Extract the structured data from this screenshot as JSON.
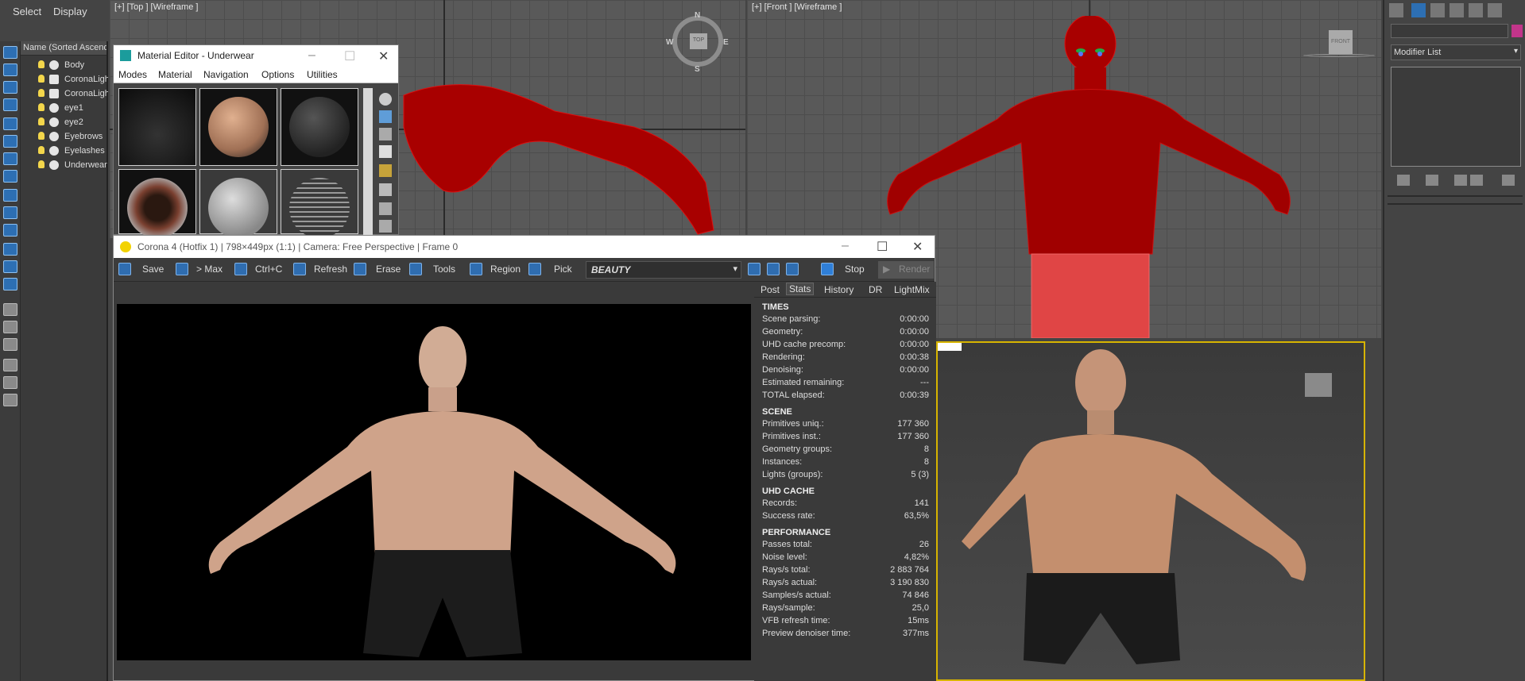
{
  "menu": {
    "select": "Select",
    "display": "Display"
  },
  "explorer": {
    "header": "Name (Sorted Ascendi",
    "items": [
      {
        "label": "Body",
        "type": "object"
      },
      {
        "label": "CoronaLigh",
        "type": "light"
      },
      {
        "label": "CoronaLigh",
        "type": "light"
      },
      {
        "label": "eye1",
        "type": "object"
      },
      {
        "label": "eye2",
        "type": "object"
      },
      {
        "label": "Eyebrows",
        "type": "object"
      },
      {
        "label": "Eyelashes",
        "type": "object"
      },
      {
        "label": "Underwear",
        "type": "object"
      }
    ]
  },
  "viewports": {
    "top_label": "[+] [Top ] [Wireframe ]",
    "front_label": "[+] [Front ] [Wireframe ]",
    "compass": {
      "n": "N",
      "s": "S",
      "e": "E",
      "w": "W",
      "cube": "TOP"
    },
    "front_cube": "FRONT"
  },
  "command_panel": {
    "modifier_list": "Modifier List",
    "accent": "#c2358a"
  },
  "material_editor": {
    "title": "Material Editor - Underwear",
    "menu": [
      "Modes",
      "Material",
      "Navigation",
      "Options",
      "Utilities"
    ]
  },
  "vfb": {
    "title": "Corona 4 (Hotfix 1) | 798×449px (1:1) | Camera: Free Perspective | Frame 0",
    "toolbar": {
      "save": "Save",
      "max": "> Max",
      "ctrlc": "Ctrl+C",
      "refresh": "Refresh",
      "erase": "Erase",
      "tools": "Tools",
      "region": "Region",
      "pick": "Pick",
      "channel": "BEAUTY",
      "stop": "Stop",
      "render": "Render"
    },
    "tabs": [
      "Post",
      "Stats",
      "History",
      "DR",
      "LightMix"
    ],
    "active_tab": "Stats",
    "sections": [
      {
        "title": "TIMES",
        "rows": [
          {
            "k": "Scene parsing:",
            "v": "0:00:00"
          },
          {
            "k": "Geometry:",
            "v": "0:00:00"
          },
          {
            "k": "UHD cache precomp:",
            "v": "0:00:00"
          },
          {
            "k": "Rendering:",
            "v": "0:00:38"
          },
          {
            "k": "Denoising:",
            "v": "0:00:00"
          },
          {
            "k": "Estimated remaining:",
            "v": "---"
          },
          {
            "k": "TOTAL elapsed:",
            "v": "0:00:39"
          }
        ]
      },
      {
        "title": "SCENE",
        "rows": [
          {
            "k": "Primitives uniq.:",
            "v": "177 360"
          },
          {
            "k": "Primitives inst.:",
            "v": "177 360"
          },
          {
            "k": "Geometry groups:",
            "v": "8"
          },
          {
            "k": "Instances:",
            "v": "8"
          },
          {
            "k": "Lights (groups):",
            "v": "5 (3)"
          }
        ]
      },
      {
        "title": "UHD CACHE",
        "rows": [
          {
            "k": "Records:",
            "v": "141"
          },
          {
            "k": "Success rate:",
            "v": "63,5%"
          }
        ]
      },
      {
        "title": "PERFORMANCE",
        "rows": [
          {
            "k": "Passes total:",
            "v": "26"
          },
          {
            "k": "Noise level:",
            "v": "4,82%"
          },
          {
            "k": "Rays/s total:",
            "v": "2 883 764"
          },
          {
            "k": "Rays/s actual:",
            "v": "3 190 830"
          },
          {
            "k": "Samples/s actual:",
            "v": "74 846"
          },
          {
            "k": "Rays/sample:",
            "v": "25,0"
          },
          {
            "k": "VFB refresh time:",
            "v": "15ms"
          },
          {
            "k": "Preview denoiser time:",
            "v": "377ms"
          }
        ]
      }
    ]
  }
}
